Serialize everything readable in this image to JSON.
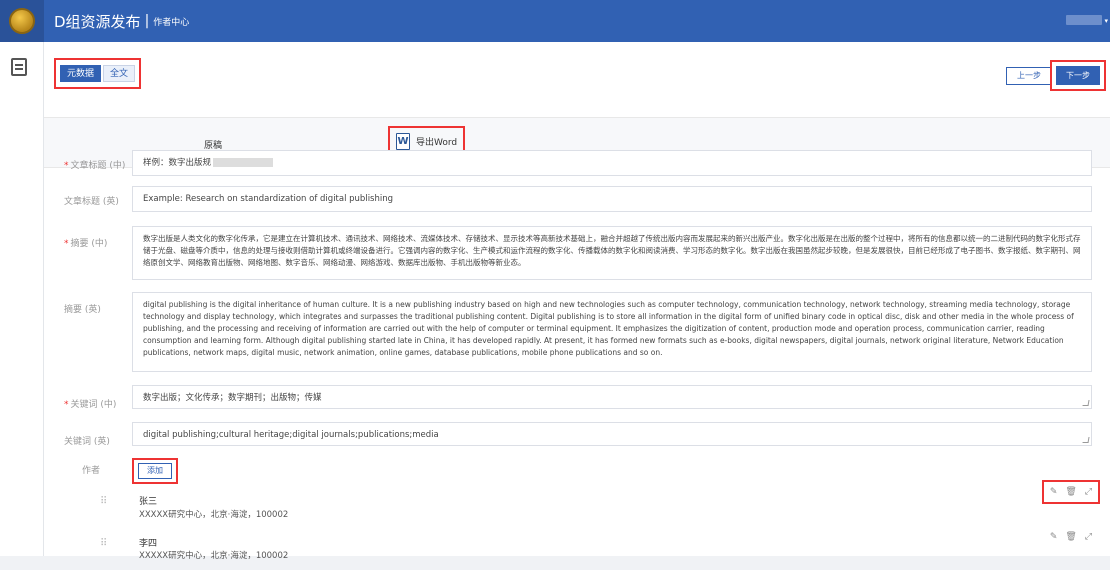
{
  "header": {
    "title": "D组资源发布",
    "divider": "|",
    "subtitle": "作者中心"
  },
  "toolbar": {
    "tabs": [
      {
        "label": "元数据",
        "active": true
      },
      {
        "label": "全文",
        "active": false
      }
    ],
    "prev_label": "上一步",
    "next_label": "下一步"
  },
  "view_tabs": {
    "original_label": "原稿",
    "export_icon": "W",
    "export_label": "导出Word"
  },
  "form": {
    "title_cn": {
      "label": "文章标题 (中)",
      "required": "*",
      "value": "样例：数字出版规"
    },
    "title_en": {
      "label": "文章标题 (英)",
      "value": "Example: Research on standardization of digital publishing"
    },
    "abstract_cn": {
      "label": "摘要 (中)",
      "required": "*",
      "value": "数字出版是人类文化的数字化传承，它是建立在计算机技术、通讯技术、网络技术、流媒体技术、存储技术、显示技术等高新技术基础上，融合并超越了传统出版内容而发展起来的新兴出版产业。数字化出版是在出版的整个过程中，将所有的信息都以统一的二进制代码的数字化形式存储于光盘、磁盘等介质中，信息的处理与接收则借助计算机或终端设备进行。它强调内容的数字化、生产模式和运作流程的数字化、传播载体的数字化和阅读消费、学习形态的数字化。数字出版在我国虽然起步较晚，但是发展很快，目前已经形成了电子图书、数字报纸、数字期刊、网络原创文学、网络教育出版物、网络地图、数字音乐、网络动漫、网络游戏、数据库出版物、手机出版物等新业态。"
    },
    "abstract_en": {
      "label": "摘要 (英)",
      "value": "digital publishing is the digital inheritance of human culture. It is a new publishing industry based on high and new technologies such as computer technology, communication technology, network technology, streaming media technology, storage technology and display technology, which integrates and surpasses the traditional publishing content. Digital publishing is to store all information in the digital form of unified binary code in optical disc, disk and other media in the whole process of publishing, and the processing and receiving of information are carried out with the help of computer or terminal equipment. It emphasizes the digitization of content, production mode and operation process, communication carrier, reading consumption and learning form. Although digital publishing started late in China, it has developed rapidly. At present, it has formed new formats such as e-books, digital newspapers, digital journals, network original literature, Network Education publications, network maps, digital music, network animation, online games, database publications, mobile phone publications and so on."
    },
    "keywords_cn": {
      "label": "关键词 (中)",
      "required": "*",
      "value": "数字出版；文化传承；数字期刊；出版物；传媒"
    },
    "keywords_en": {
      "label": "关键词 (英)",
      "value": "digital publishing;cultural heritage;digital journals;publications;media"
    },
    "authors_label": "作者",
    "add_label": "添加"
  },
  "authors": [
    {
      "name": "张三",
      "address": "XXXXX研究中心，北京·海淀，100002"
    },
    {
      "name": "李四",
      "address": "XXXXX研究中心，北京·海淀，100002"
    }
  ],
  "icons": {
    "edit": "✎",
    "delete": "🗑",
    "expand": "⤢",
    "drag": "⠿"
  }
}
